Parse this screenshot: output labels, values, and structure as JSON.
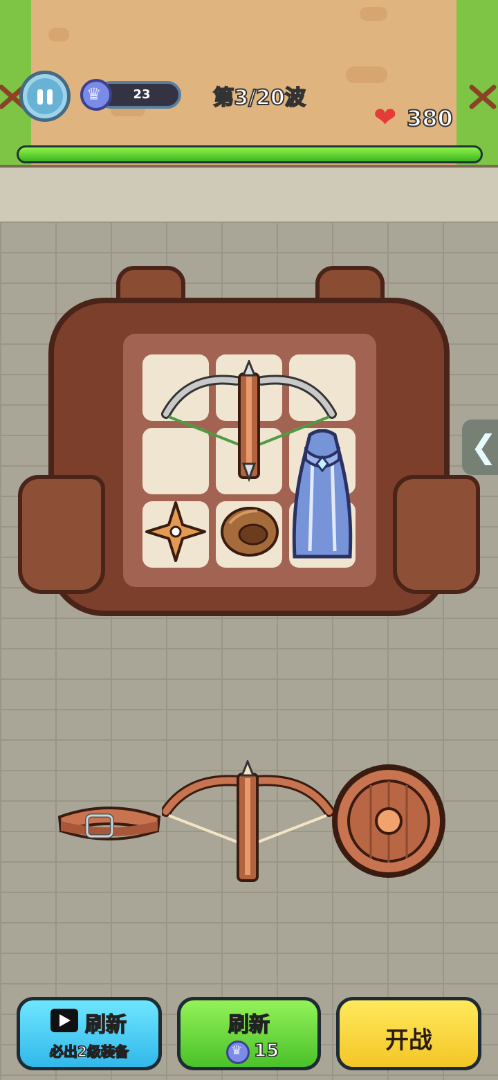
{
  "hud": {
    "gem_count": "23",
    "wave_label": "第3/20波",
    "health": "380",
    "health_bar_fraction": 1.0,
    "colors": {
      "health_fill": "#3cb51f",
      "heart": "#e43b3b",
      "gem": "#7b8be8"
    }
  },
  "backpack": {
    "grid_rows": 3,
    "grid_cols": 3,
    "items": [
      {
        "name": "crossbow",
        "icon": "crossbow-icon"
      },
      {
        "name": "cloak",
        "icon": "cloak-icon"
      },
      {
        "name": "shuriken",
        "icon": "shuriken-icon"
      },
      {
        "name": "ring",
        "icon": "ring-icon"
      }
    ]
  },
  "shop": {
    "items": [
      {
        "name": "belt",
        "icon": "belt-icon"
      },
      {
        "name": "crossbow",
        "icon": "crossbow-icon"
      },
      {
        "name": "shield",
        "icon": "shield-icon"
      }
    ]
  },
  "buttons": {
    "ad_refresh_title": "刷新",
    "ad_refresh_subtitle": "必出2级装备",
    "refresh_title": "刷新",
    "refresh_cost": "15",
    "start_label": "开战"
  }
}
